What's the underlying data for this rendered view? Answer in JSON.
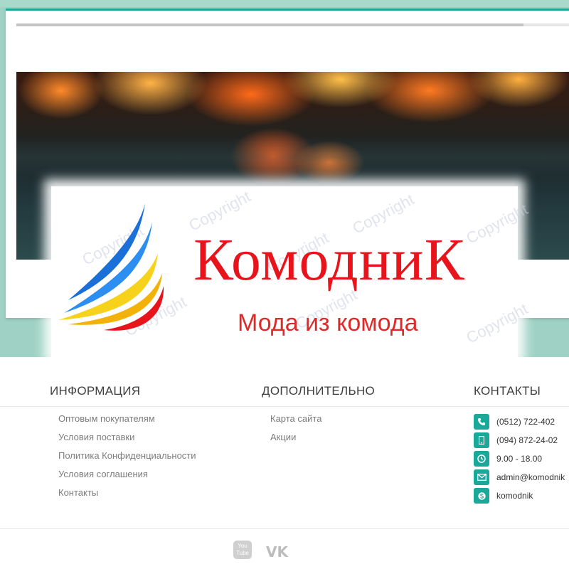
{
  "header": {
    "progress_fraction": 0.918
  },
  "logo": {
    "brand_name": "КомодниК",
    "slogan": "Мода из комода",
    "watermark_text": "Copyright"
  },
  "footer": {
    "info": {
      "title": "ИНФОРМАЦИЯ",
      "links": [
        "Оптовым покупателям",
        "Условия поставки",
        "Политика Конфиденциальности",
        "Условия соглашения",
        "Контакты"
      ]
    },
    "extra": {
      "title": "ДОПОЛНИТЕЛЬНО",
      "links": [
        "Карта сайта",
        "Акции"
      ]
    },
    "contacts": {
      "title": "КОНТАКТЫ",
      "items": [
        {
          "icon": "phone-icon",
          "text": "(0512) 722-402"
        },
        {
          "icon": "mobile-icon",
          "text": "(094) 872-24-02"
        },
        {
          "icon": "clock-icon",
          "text": "9.00 - 18.00"
        },
        {
          "icon": "mail-icon",
          "text": "admin@komodnik"
        },
        {
          "icon": "skype-icon",
          "text": "komodnik"
        }
      ]
    },
    "social": {
      "youtube_label_top": "You",
      "youtube_label_bottom": "Tube",
      "vk_label": "VK"
    }
  },
  "colors": {
    "accent": "#1aa89b",
    "brand_red": "#e8141c",
    "page_background": "#9fd2c4"
  }
}
